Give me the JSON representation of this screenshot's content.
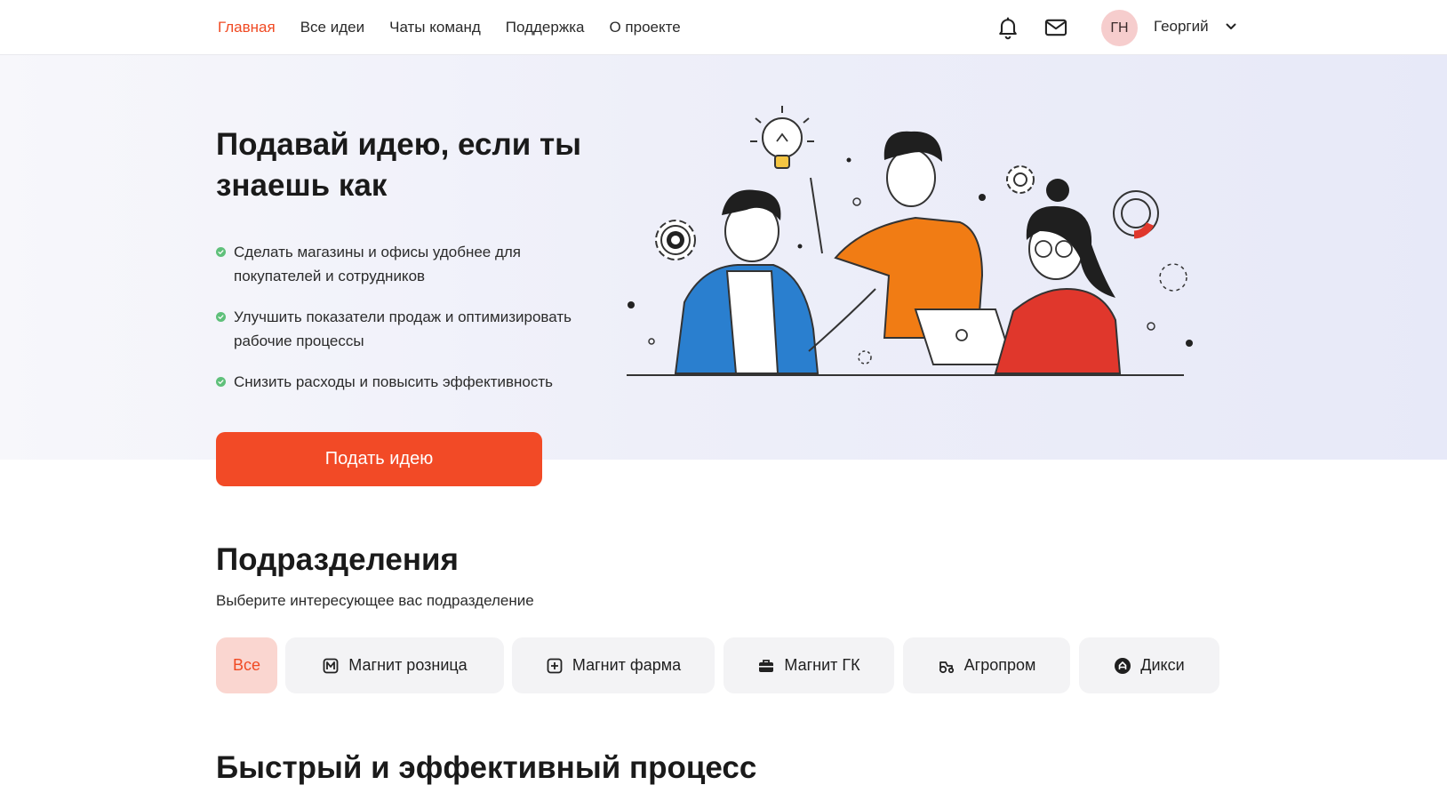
{
  "nav": {
    "items": [
      {
        "label": "Главная",
        "active": true
      },
      {
        "label": "Все идеи",
        "active": false
      },
      {
        "label": "Чаты команд",
        "active": false
      },
      {
        "label": "Поддержка",
        "active": false
      },
      {
        "label": "О проекте",
        "active": false
      }
    ]
  },
  "header": {
    "icons": [
      "bell-icon",
      "mail-icon"
    ],
    "user": {
      "initials": "ГН",
      "name": "Георгий"
    }
  },
  "hero": {
    "title": "Подавай идею, если ты знаешь как",
    "benefits": [
      "Сделать магазины и офисы удобнее для покупателей и сотрудников",
      "Улучшить показатели продаж и оптимизировать рабочие процессы",
      "Снизить расходы и повысить эффективность"
    ],
    "cta_label": "Подать идею"
  },
  "divisions": {
    "title": "Подразделения",
    "subtitle": "Выберите интересующее вас подразделение",
    "chips": [
      {
        "label": "Все",
        "active": true,
        "icon": ""
      },
      {
        "label": "Магнит розница",
        "active": false,
        "icon": "magnit-retail-icon"
      },
      {
        "label": "Магнит фарма",
        "active": false,
        "icon": "magnit-pharma-icon"
      },
      {
        "label": "Магнит ГК",
        "active": false,
        "icon": "briefcase-icon"
      },
      {
        "label": "Агропром",
        "active": false,
        "icon": "tractor-icon"
      },
      {
        "label": "Дикси",
        "active": false,
        "icon": "dixy-logo-icon"
      }
    ]
  },
  "process": {
    "title": "Быстрый и эффективный процесс"
  },
  "colors": {
    "accent": "#f24a26",
    "chip_active_bg": "#fad6d0",
    "benefit_dot": "#5fc07a"
  }
}
